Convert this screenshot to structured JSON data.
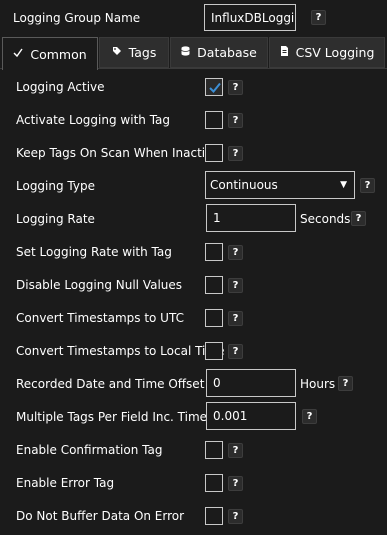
{
  "group": {
    "label": "Logging Group Name",
    "value": "InfluxDBLogging"
  },
  "help_glyph": "?",
  "tabs": [
    {
      "label": "Common",
      "icon": "tag-check-icon"
    },
    {
      "label": "Tags",
      "icon": "tag-icon"
    },
    {
      "label": "Database",
      "icon": "database-icon"
    },
    {
      "label": "CSV Logging",
      "icon": "csv-file-icon"
    }
  ],
  "settings": {
    "logging_active": {
      "label": "Logging Active",
      "checked": true
    },
    "activate_logging_with_tag": {
      "label": "Activate Logging with Tag",
      "checked": false
    },
    "keep_tags_on_scan": {
      "label": "Keep Tags On Scan When Inactive",
      "checked": false
    },
    "logging_type": {
      "label": "Logging Type",
      "value": "Continuous"
    },
    "logging_rate": {
      "label": "Logging Rate",
      "value": "1",
      "unit": "Seconds"
    },
    "set_logging_rate_with_tag": {
      "label": "Set Logging Rate with Tag",
      "checked": false
    },
    "disable_null_values": {
      "label": "Disable Logging Null Values",
      "checked": false
    },
    "convert_utc": {
      "label": "Convert Timestamps to UTC",
      "checked": false
    },
    "convert_local": {
      "label": "Convert Timestamps to Local Time",
      "checked": false
    },
    "recorded_offset": {
      "label": "Recorded Date and Time Offset",
      "value": "0",
      "unit": "Hours"
    },
    "multiple_tags": {
      "label": "Multiple Tags Per Field Inc. Time",
      "value": "0.001"
    },
    "confirmation_tag": {
      "label": "Enable Confirmation Tag",
      "checked": false
    },
    "error_tag": {
      "label": "Enable Error Tag",
      "checked": false
    },
    "no_buffer": {
      "label": "Do Not Buffer Data On Error",
      "checked": false
    }
  },
  "colors": {
    "background": "#1b1b1b",
    "border": "#c8c8c8",
    "check_accent": "#3c8fd6",
    "tab_inactive": "#2e2e2e"
  }
}
